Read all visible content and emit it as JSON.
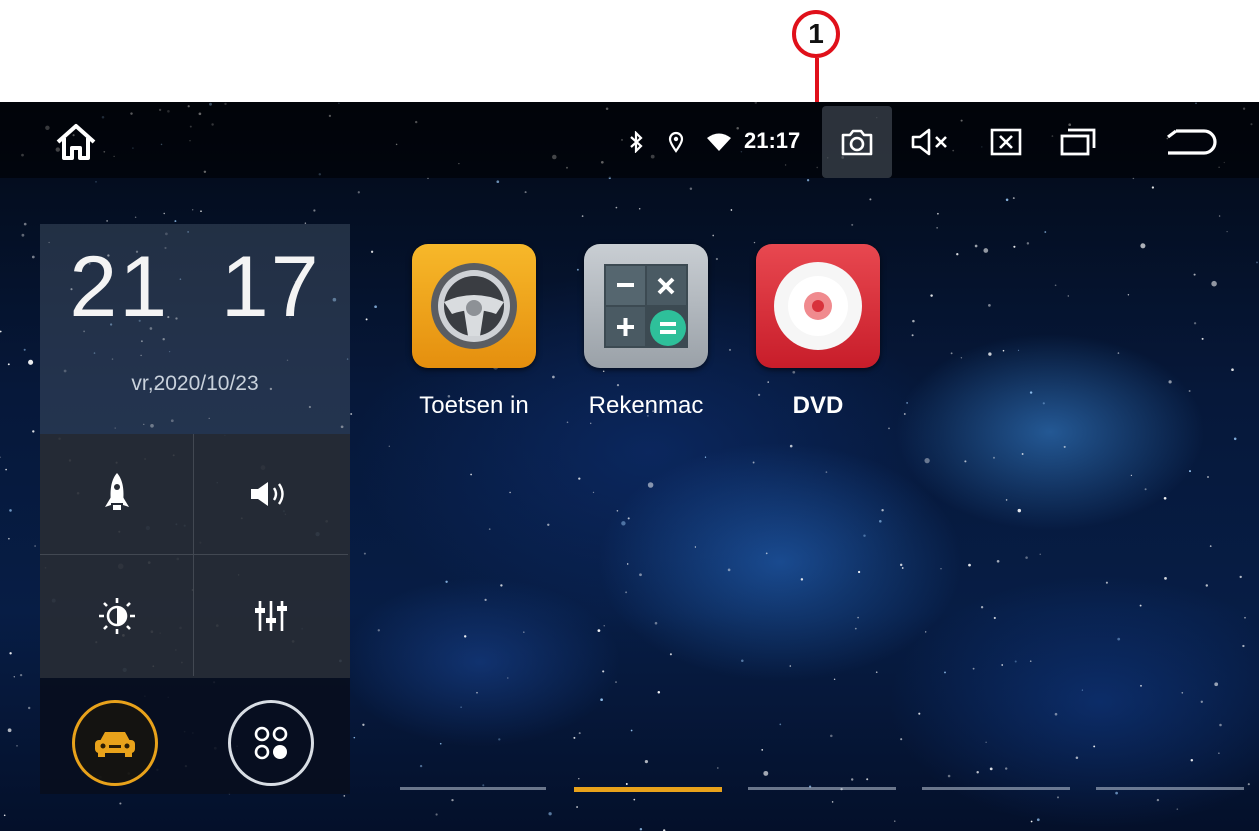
{
  "annotation": {
    "marker": "1",
    "color": "#e0101a"
  },
  "status_bar": {
    "home_icon": "home-icon",
    "bluetooth_icon": "bluetooth-icon",
    "location_icon": "location-pin-icon",
    "wifi_icon": "wifi-icon",
    "time": "21:17",
    "camera_icon": "camera-icon",
    "mute_icon": "speaker-mute-icon",
    "close_icon": "close-box-icon",
    "recents_icon": "recent-apps-icon",
    "back_icon": "back-arrow-icon"
  },
  "widget": {
    "clock_hour": "21",
    "clock_minute": "17",
    "date": "vr,2020/10/23",
    "quick_actions": [
      {
        "icon": "rocket-icon"
      },
      {
        "icon": "volume-icon"
      },
      {
        "icon": "brightness-icon"
      },
      {
        "icon": "equalizer-icon"
      }
    ],
    "car_button_icon": "car-icon",
    "car_accent": "#e8a21b",
    "apps_button_icon": "app-drawer-icon"
  },
  "apps": [
    {
      "label": "Toetsen in",
      "icon": "steering-wheel-icon"
    },
    {
      "label": "Rekenmac",
      "icon": "calculator-icon"
    },
    {
      "label": "DVD",
      "icon": "disc-icon"
    }
  ],
  "page_indicator": {
    "total": 5,
    "active_index": 1,
    "active_color": "#e8a21b"
  }
}
